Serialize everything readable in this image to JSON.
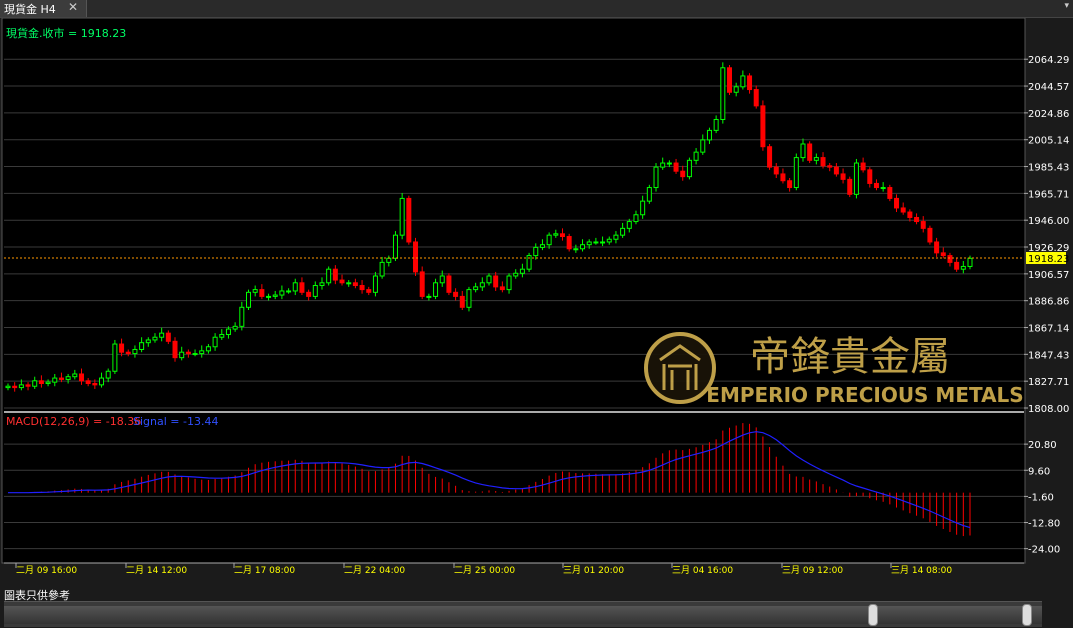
{
  "tab": {
    "title": "現貨金 H4",
    "close_glyph": "✕",
    "menu_glyph": "▾"
  },
  "price_label": "現貨金.收市 = 1918.23",
  "macd_label": {
    "macd": "MACD(12,26,9) = -18.36",
    "signal": "Signal = -13.44"
  },
  "current_price": "1918.23",
  "watermark": {
    "brand_cn": "帝鋒貴金屬",
    "brand_en": "EMPERIO PRECIOUS METALS"
  },
  "footer_note": "圖表只供參考",
  "colors": {
    "up": "#00ff00",
    "down": "#ff0000",
    "signal": "#2020ff",
    "axis_text": "#ffffff",
    "current": "#ffff00",
    "gold": "#c9a84c"
  },
  "chart_data": [
    {
      "type": "candlestick",
      "title": "現貨金 H4",
      "y_ticks": [
        "2064.29",
        "2044.57",
        "2024.86",
        "2005.14",
        "1985.43",
        "1965.71",
        "1946.00",
        "1926.29",
        "1906.57",
        "1886.86",
        "1867.14",
        "1847.43",
        "1827.71",
        "1808.00"
      ],
      "ylim": [
        1808.0,
        2074.0
      ],
      "x_ticks": [
        "二月 09 16:00",
        "二月 14 12:00",
        "二月 17 08:00",
        "二月 22 04:00",
        "二月 25 00:00",
        "三月 01 20:00",
        "三月 04 16:00",
        "三月 09 12:00",
        "三月 14 08:00"
      ],
      "close_last": 1918.23,
      "closes": [
        1824,
        1823,
        1825,
        1824,
        1828,
        1826,
        1827,
        1830,
        1829,
        1831,
        1833,
        1828,
        1826,
        1825,
        1830,
        1835,
        1855,
        1849,
        1848,
        1851,
        1856,
        1858,
        1860,
        1863,
        1857,
        1845,
        1849,
        1848,
        1848,
        1850,
        1853,
        1860,
        1862,
        1866,
        1868,
        1882,
        1893,
        1895,
        1890,
        1890,
        1891,
        1894,
        1894,
        1900,
        1893,
        1890,
        1898,
        1900,
        1910,
        1902,
        1900,
        1900,
        1898,
        1895,
        1893,
        1905,
        1915,
        1918,
        1935,
        1962,
        1930,
        1908,
        1890,
        1890,
        1900,
        1905,
        1893,
        1890,
        1882,
        1895,
        1897,
        1900,
        1905,
        1897,
        1895,
        1905,
        1907,
        1910,
        1920,
        1926,
        1928,
        1935,
        1936,
        1934,
        1925,
        1925,
        1928,
        1930,
        1930,
        1930,
        1932,
        1935,
        1940,
        1945,
        1950,
        1960,
        1970,
        1985,
        1988,
        1988,
        1982,
        1978,
        1990,
        1996,
        2005,
        2012,
        2020,
        2058,
        2040,
        2044,
        2052,
        2042,
        2030,
        2000,
        1985,
        1980,
        1975,
        1970,
        1992,
        2002,
        1990,
        1992,
        1986,
        1985,
        1980,
        1976,
        1965,
        1988,
        1983,
        1973,
        1970,
        1970,
        1962,
        1955,
        1952,
        1948,
        1945,
        1940,
        1930,
        1922,
        1920,
        1915,
        1910,
        1912,
        1918
      ]
    },
    {
      "type": "bar+line",
      "title": "MACD(12,26,9)",
      "y_ticks": [
        "20.80",
        "9.60",
        "-1.60",
        "-12.80",
        "-24.00"
      ],
      "ylim": [
        -28.0,
        32.0
      ],
      "macd_last": -18.36,
      "signal_last": -13.44
    }
  ]
}
